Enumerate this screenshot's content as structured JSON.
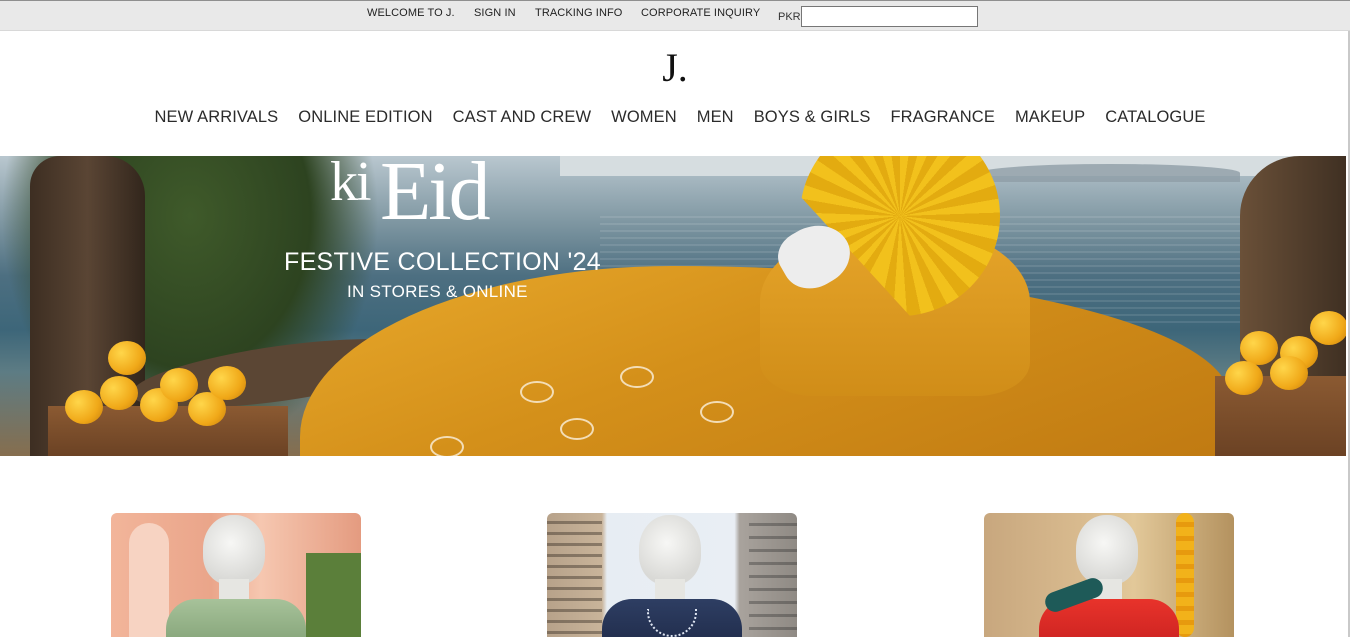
{
  "topbar": {
    "welcome": "WELCOME TO J.",
    "sign_in": "SIGN IN",
    "tracking": "TRACKING INFO",
    "corporate": "CORPORATE INQUIRY",
    "currency_label": "PKR",
    "currency_value": ""
  },
  "header": {
    "logo": "J."
  },
  "nav": {
    "items": [
      "NEW ARRIVALS",
      "ONLINE EDITION",
      "CAST AND CREW",
      "WOMEN",
      "MEN",
      "BOYS & GIRLS",
      "FRAGRANCE",
      "MAKEUP",
      "CATALOGUE"
    ]
  },
  "hero": {
    "title_ki": "ki",
    "title_eid": "Eid",
    "headline": "FESTIVE COLLECTION '24",
    "subline": "IN STORES & ONLINE"
  },
  "colors": {
    "topbar_bg": "#e9e9e9",
    "nav_text": "#2b2b2b",
    "hero_accent": "#e3a01e"
  }
}
